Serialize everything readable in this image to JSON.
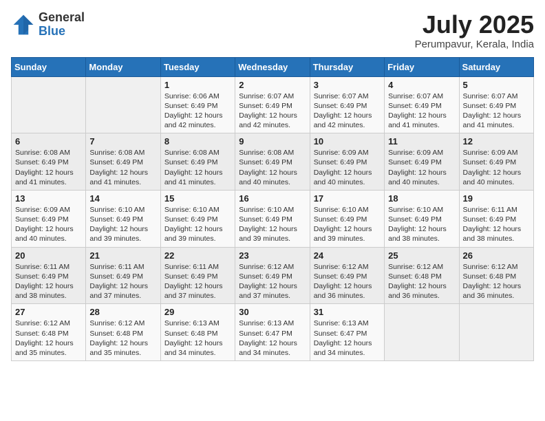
{
  "header": {
    "logo_general": "General",
    "logo_blue": "Blue",
    "month_title": "July 2025",
    "location": "Perumpavur, Kerala, India"
  },
  "days_of_week": [
    "Sunday",
    "Monday",
    "Tuesday",
    "Wednesday",
    "Thursday",
    "Friday",
    "Saturday"
  ],
  "weeks": [
    [
      {
        "num": "",
        "info": ""
      },
      {
        "num": "",
        "info": ""
      },
      {
        "num": "1",
        "info": "Sunrise: 6:06 AM\nSunset: 6:49 PM\nDaylight: 12 hours and 42 minutes."
      },
      {
        "num": "2",
        "info": "Sunrise: 6:07 AM\nSunset: 6:49 PM\nDaylight: 12 hours and 42 minutes."
      },
      {
        "num": "3",
        "info": "Sunrise: 6:07 AM\nSunset: 6:49 PM\nDaylight: 12 hours and 42 minutes."
      },
      {
        "num": "4",
        "info": "Sunrise: 6:07 AM\nSunset: 6:49 PM\nDaylight: 12 hours and 41 minutes."
      },
      {
        "num": "5",
        "info": "Sunrise: 6:07 AM\nSunset: 6:49 PM\nDaylight: 12 hours and 41 minutes."
      }
    ],
    [
      {
        "num": "6",
        "info": "Sunrise: 6:08 AM\nSunset: 6:49 PM\nDaylight: 12 hours and 41 minutes."
      },
      {
        "num": "7",
        "info": "Sunrise: 6:08 AM\nSunset: 6:49 PM\nDaylight: 12 hours and 41 minutes."
      },
      {
        "num": "8",
        "info": "Sunrise: 6:08 AM\nSunset: 6:49 PM\nDaylight: 12 hours and 41 minutes."
      },
      {
        "num": "9",
        "info": "Sunrise: 6:08 AM\nSunset: 6:49 PM\nDaylight: 12 hours and 40 minutes."
      },
      {
        "num": "10",
        "info": "Sunrise: 6:09 AM\nSunset: 6:49 PM\nDaylight: 12 hours and 40 minutes."
      },
      {
        "num": "11",
        "info": "Sunrise: 6:09 AM\nSunset: 6:49 PM\nDaylight: 12 hours and 40 minutes."
      },
      {
        "num": "12",
        "info": "Sunrise: 6:09 AM\nSunset: 6:49 PM\nDaylight: 12 hours and 40 minutes."
      }
    ],
    [
      {
        "num": "13",
        "info": "Sunrise: 6:09 AM\nSunset: 6:49 PM\nDaylight: 12 hours and 40 minutes."
      },
      {
        "num": "14",
        "info": "Sunrise: 6:10 AM\nSunset: 6:49 PM\nDaylight: 12 hours and 39 minutes."
      },
      {
        "num": "15",
        "info": "Sunrise: 6:10 AM\nSunset: 6:49 PM\nDaylight: 12 hours and 39 minutes."
      },
      {
        "num": "16",
        "info": "Sunrise: 6:10 AM\nSunset: 6:49 PM\nDaylight: 12 hours and 39 minutes."
      },
      {
        "num": "17",
        "info": "Sunrise: 6:10 AM\nSunset: 6:49 PM\nDaylight: 12 hours and 39 minutes."
      },
      {
        "num": "18",
        "info": "Sunrise: 6:10 AM\nSunset: 6:49 PM\nDaylight: 12 hours and 38 minutes."
      },
      {
        "num": "19",
        "info": "Sunrise: 6:11 AM\nSunset: 6:49 PM\nDaylight: 12 hours and 38 minutes."
      }
    ],
    [
      {
        "num": "20",
        "info": "Sunrise: 6:11 AM\nSunset: 6:49 PM\nDaylight: 12 hours and 38 minutes."
      },
      {
        "num": "21",
        "info": "Sunrise: 6:11 AM\nSunset: 6:49 PM\nDaylight: 12 hours and 37 minutes."
      },
      {
        "num": "22",
        "info": "Sunrise: 6:11 AM\nSunset: 6:49 PM\nDaylight: 12 hours and 37 minutes."
      },
      {
        "num": "23",
        "info": "Sunrise: 6:12 AM\nSunset: 6:49 PM\nDaylight: 12 hours and 37 minutes."
      },
      {
        "num": "24",
        "info": "Sunrise: 6:12 AM\nSunset: 6:49 PM\nDaylight: 12 hours and 36 minutes."
      },
      {
        "num": "25",
        "info": "Sunrise: 6:12 AM\nSunset: 6:48 PM\nDaylight: 12 hours and 36 minutes."
      },
      {
        "num": "26",
        "info": "Sunrise: 6:12 AM\nSunset: 6:48 PM\nDaylight: 12 hours and 36 minutes."
      }
    ],
    [
      {
        "num": "27",
        "info": "Sunrise: 6:12 AM\nSunset: 6:48 PM\nDaylight: 12 hours and 35 minutes."
      },
      {
        "num": "28",
        "info": "Sunrise: 6:12 AM\nSunset: 6:48 PM\nDaylight: 12 hours and 35 minutes."
      },
      {
        "num": "29",
        "info": "Sunrise: 6:13 AM\nSunset: 6:48 PM\nDaylight: 12 hours and 34 minutes."
      },
      {
        "num": "30",
        "info": "Sunrise: 6:13 AM\nSunset: 6:47 PM\nDaylight: 12 hours and 34 minutes."
      },
      {
        "num": "31",
        "info": "Sunrise: 6:13 AM\nSunset: 6:47 PM\nDaylight: 12 hours and 34 minutes."
      },
      {
        "num": "",
        "info": ""
      },
      {
        "num": "",
        "info": ""
      }
    ]
  ]
}
